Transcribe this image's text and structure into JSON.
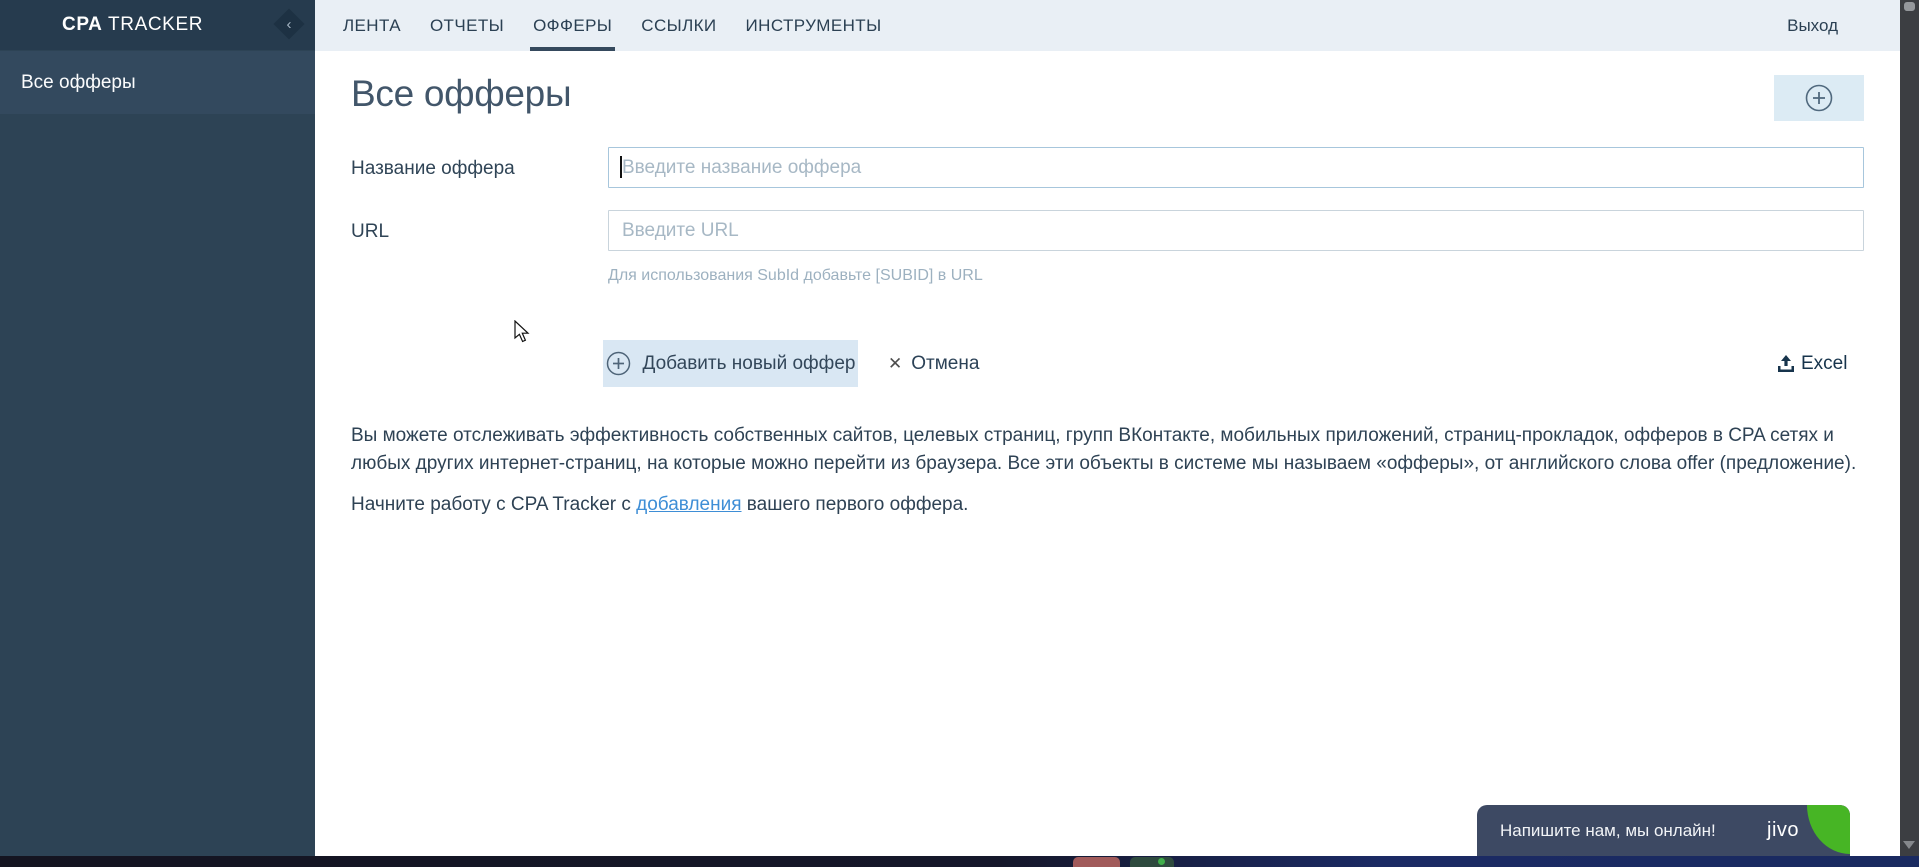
{
  "app": {
    "brand_bold": "CPA",
    "brand_rest": " TRACKER"
  },
  "header": {
    "tabs": [
      {
        "label": "ЛЕНТА",
        "active": false
      },
      {
        "label": "ОТЧЕТЫ",
        "active": false
      },
      {
        "label": "ОФФЕРЫ",
        "active": true
      },
      {
        "label": "ССЫЛКИ",
        "active": false
      },
      {
        "label": "ИНСТРУМЕНТЫ",
        "active": false
      }
    ],
    "logout_label": "Выход",
    "collapse_glyph": "‹"
  },
  "sidebar": {
    "items": [
      {
        "label": "Все офферы",
        "active": true
      }
    ]
  },
  "main": {
    "title": "Все офферы",
    "form": {
      "name_label": "Название оффера",
      "name_placeholder": "Введите название оффера",
      "url_label": "URL",
      "url_placeholder": "Введите URL",
      "hint": "Для использования SubId добавьте [SUBID] в URL",
      "submit_label": "Добавить новый оффер",
      "cancel_label": "Отмена",
      "cancel_glyph": "✕",
      "excel_label": "Excel"
    },
    "description": {
      "line1": "Вы можете отслеживать эффективность собственных сайтов, целевых страниц, групп ВКонтакте, мобильных приложений, страниц-прокладок, офферов в CPA сетях и",
      "line2": "любых других интернет-страниц, на которые можно перейти из браузера. Все эти объекты в системе мы называем «офферы», от английского слова offer (предложение)."
    },
    "start": {
      "before": "Начните работу с CPA Tracker с ",
      "link": "добавления",
      "after": " вашего первого оффера."
    }
  },
  "chat": {
    "message": "Напишите нам, мы онлайн!",
    "logo": "jivo"
  },
  "colors": {
    "sidebar_bg": "#2d4355",
    "sidebar_header_bg": "#263b4e",
    "sidebar_item_bg": "#33495e",
    "nav_bg": "#e9eff5",
    "nav_text": "#2b4053",
    "accent_button_bg": "#d9e7f3",
    "focused_input_border": "#a7c6dc",
    "link": "#3e8ed6",
    "chat_bg": "#3d4963",
    "chat_leaf": "#47b525"
  }
}
